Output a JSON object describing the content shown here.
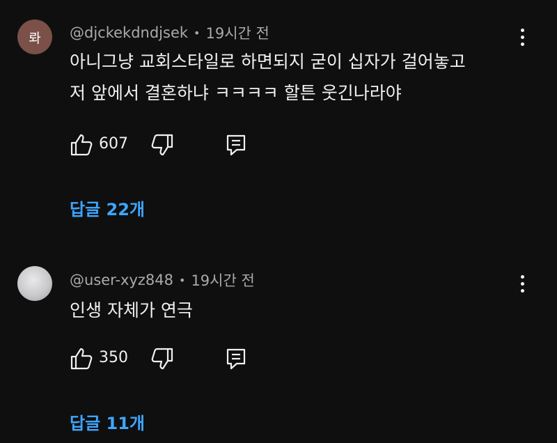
{
  "comments": [
    {
      "avatar_text": "롸",
      "avatar_color": "#7a5048",
      "username": "@djckekdndjsek",
      "separator": "•",
      "time": "19시간 전",
      "lines": [
        "아니그냥 교회스타일로 하면되지 굳이 십자가 걸어놓고",
        "저 앞에서 결혼하냐 ㅋㅋㅋㅋ 할튼 웃긴나라야"
      ],
      "likes": "607",
      "replies_label": "답글 22개"
    },
    {
      "avatar_text": "",
      "avatar_color": "#c9c9cb",
      "username": "@user-xyz848",
      "separator": "•",
      "time": "19시간 전",
      "lines": [
        "인생 자체가 연극"
      ],
      "likes": "350",
      "replies_label": "답글 11개"
    }
  ],
  "icons": {
    "like": "thumbs-up-icon",
    "dislike": "thumbs-down-icon",
    "reply": "comment-reply-icon",
    "more": "more-vert-icon"
  },
  "colors": {
    "background": "#0f0f0f",
    "link": "#3ea6ff",
    "secondary_text": "#aaaaaa"
  }
}
